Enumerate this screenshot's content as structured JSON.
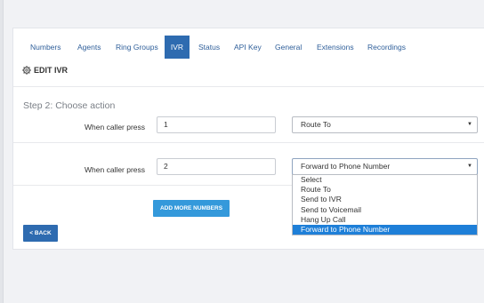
{
  "tabs": [
    {
      "label": "Numbers",
      "active": false
    },
    {
      "label": "Agents",
      "active": false
    },
    {
      "label": "Ring Groups",
      "active": false
    },
    {
      "label": "IVR",
      "active": true
    },
    {
      "label": "Status",
      "active": false
    },
    {
      "label": "API Key",
      "active": false
    },
    {
      "label": "General",
      "active": false
    },
    {
      "label": "Extensions",
      "active": false
    },
    {
      "label": "Recordings",
      "active": false
    }
  ],
  "section": {
    "title": "EDIT IVR",
    "icon": "gear-icon"
  },
  "step_title": "Step 2: Choose action",
  "rows": [
    {
      "label": "When caller press",
      "number": "1",
      "action": "Route To"
    },
    {
      "label": "When caller press",
      "number": "2",
      "action": "Forward to Phone Number"
    }
  ],
  "dropdown_options": [
    {
      "label": "Select",
      "selected": false
    },
    {
      "label": "Route To",
      "selected": false
    },
    {
      "label": "Send to IVR",
      "selected": false
    },
    {
      "label": "Send to Voicemail",
      "selected": false
    },
    {
      "label": "Hang Up Call",
      "selected": false
    },
    {
      "label": "Forward to Phone Number",
      "selected": true
    }
  ],
  "buttons": {
    "add_more": "ADD MORE NUMBERS",
    "back": "< BACK"
  },
  "colors": {
    "primary": "#2e6bb0",
    "button": "#3499db",
    "highlight": "#1e7fd8"
  }
}
